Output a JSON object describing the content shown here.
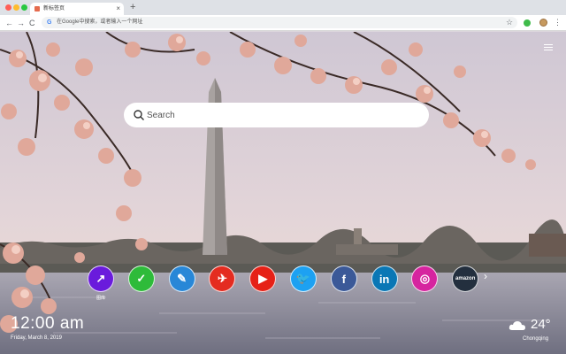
{
  "browser": {
    "tab_title": "新标签页",
    "tab_close": "×",
    "new_tab": "+",
    "address_text": "在Google中搜索，或者输入一个网址",
    "google_letter": "G",
    "back": "←",
    "forward": "→",
    "reload": "C",
    "bookmark_star": "☆",
    "menu": "⋮"
  },
  "search": {
    "placeholder": "Search"
  },
  "shortcuts": [
    {
      "name": "gallery",
      "label": "图库",
      "color": "#6a1bdc",
      "glyph": "↗"
    },
    {
      "name": "tasks",
      "label": "",
      "color": "#2ebb3a",
      "glyph": "✓"
    },
    {
      "name": "notes",
      "label": "",
      "color": "#2887d7",
      "glyph": "✎"
    },
    {
      "name": "game",
      "label": "",
      "color": "#e42c20",
      "glyph": "✈"
    },
    {
      "name": "youtube",
      "label": "",
      "color": "#e62117",
      "glyph": "▶"
    },
    {
      "name": "twitter",
      "label": "",
      "color": "#1da1f2",
      "glyph": "🐦"
    },
    {
      "name": "facebook",
      "label": "",
      "color": "#3b5998",
      "glyph": "f"
    },
    {
      "name": "linkedin",
      "label": "",
      "color": "#0a77b5",
      "glyph": "in"
    },
    {
      "name": "instagram",
      "label": "",
      "color": "#d6249f",
      "glyph": "◎"
    },
    {
      "name": "amazon",
      "label": "",
      "color": "#232f3e",
      "glyph": "amazon"
    }
  ],
  "next_arrow": "›",
  "clock": {
    "time": "12:00 am",
    "date": "Friday, March 8, 2019"
  },
  "weather": {
    "temperature": "24°",
    "city": "Chongqing",
    "icon": "cloud-sun-icon"
  }
}
